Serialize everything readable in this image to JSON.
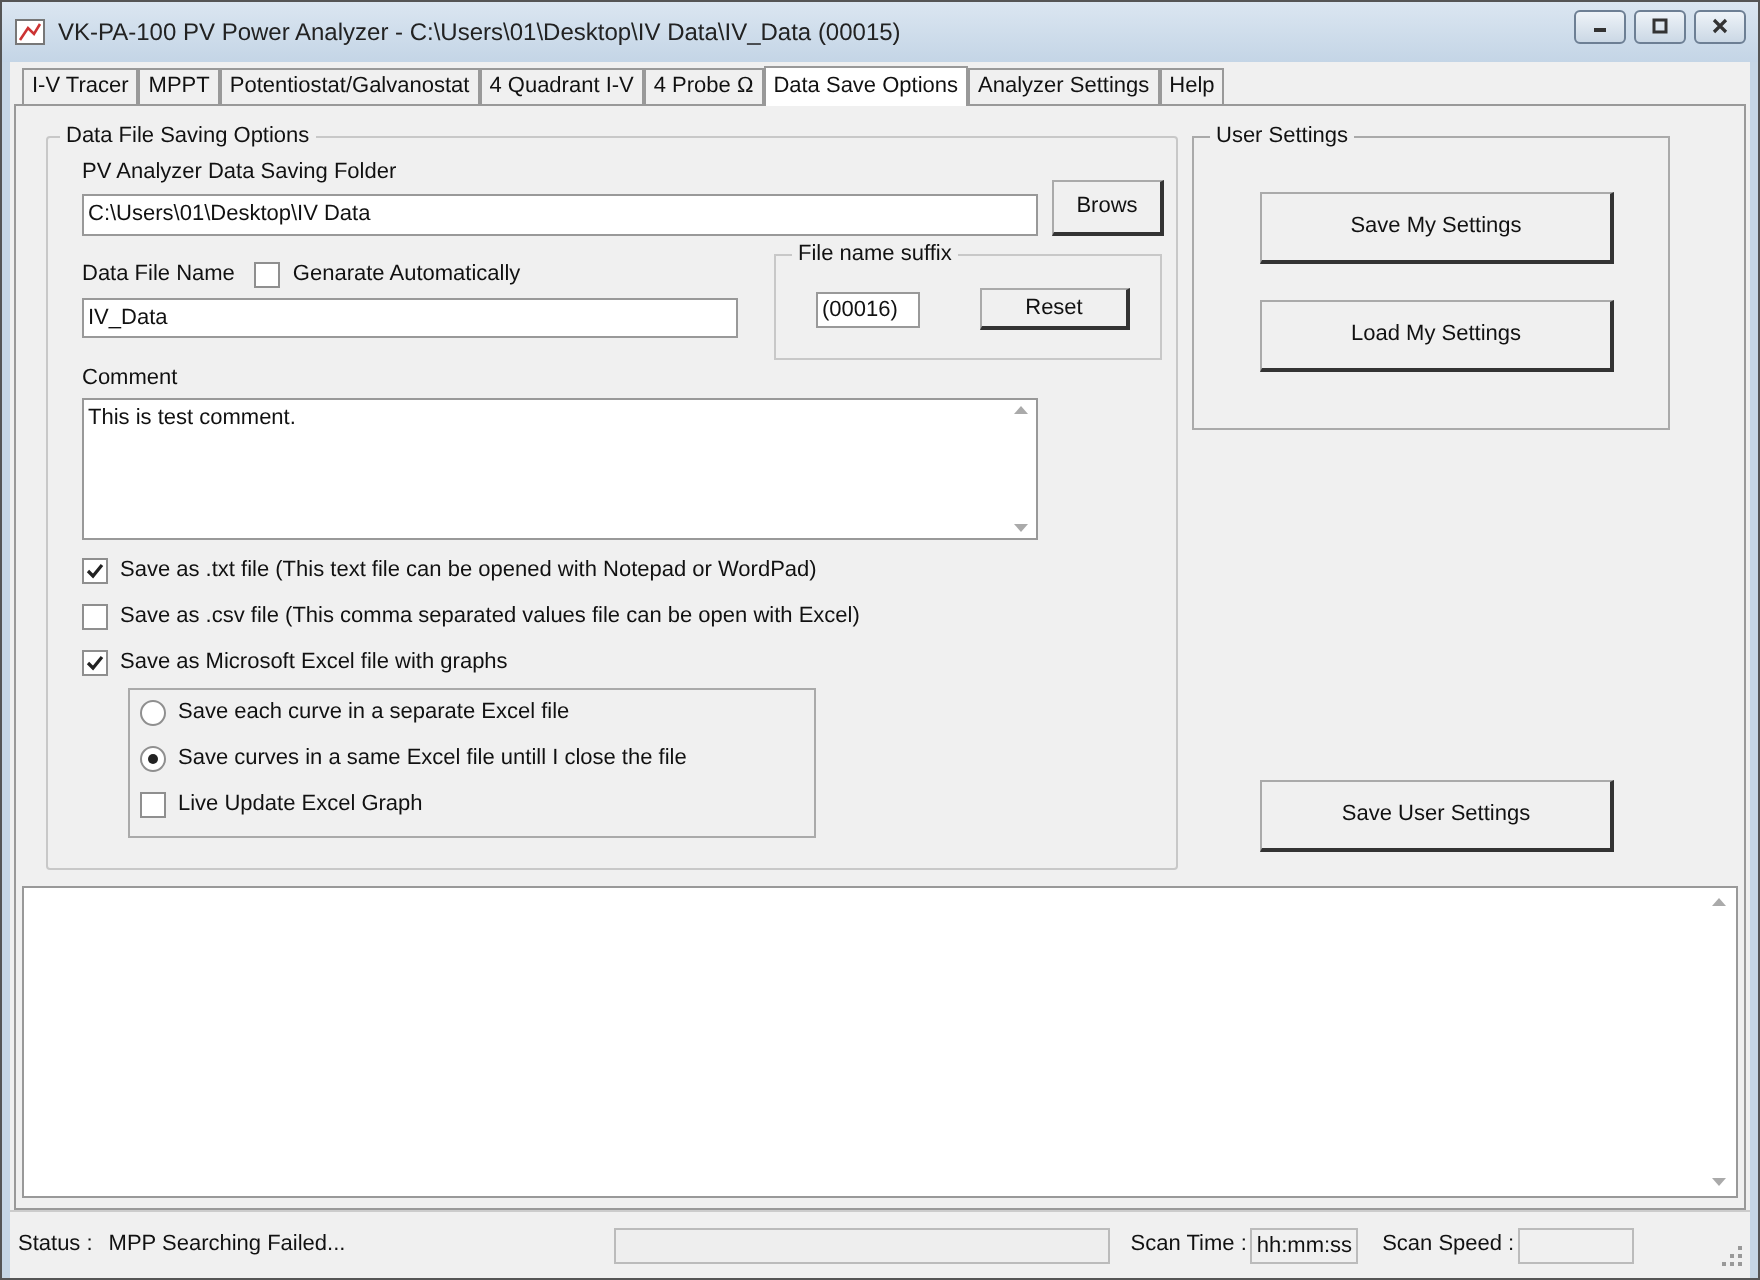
{
  "window": {
    "title": "VK-PA-100 PV Power Analyzer - C:\\Users\\01\\Desktop\\IV Data\\IV_Data (00015)"
  },
  "tabs": [
    {
      "label": "I-V Tracer",
      "selected": false
    },
    {
      "label": "MPPT",
      "selected": false
    },
    {
      "label": "Potentiostat/Galvanostat",
      "selected": false
    },
    {
      "label": "4 Quadrant I-V",
      "selected": false
    },
    {
      "label": "4 Probe Ω",
      "selected": false
    },
    {
      "label": "Data Save Options",
      "selected": true
    },
    {
      "label": "Analyzer Settings",
      "selected": false
    },
    {
      "label": "Help",
      "selected": false
    }
  ],
  "data_file_saving": {
    "title": "Data File Saving Options",
    "folder_label": "PV Analyzer Data Saving Folder",
    "folder_value": "C:\\Users\\01\\Desktop\\IV Data",
    "browse_button": "Brows",
    "file_name_label": "Data File Name",
    "auto_generate": {
      "label": "Genarate Automatically",
      "checked": false
    },
    "file_name_value": "IV_Data",
    "suffix": {
      "title": "File name suffix",
      "value": "(00016)",
      "reset_button": "Reset"
    },
    "comment_label": "Comment",
    "comment_value": "This is test comment.",
    "save_options": [
      {
        "label": "Save as .txt file (This text file can be opened with Notepad or WordPad)",
        "checked": true
      },
      {
        "label": "Save as .csv file (This comma separated values file can be open with Excel)",
        "checked": false
      },
      {
        "label": "Save as Microsoft Excel file with graphs",
        "checked": true
      }
    ],
    "excel_options": [
      {
        "kind": "radio",
        "label": "Save each curve in a separate Excel file",
        "selected": false
      },
      {
        "kind": "radio",
        "label": "Save curves in a same Excel file untill I close the file",
        "selected": true
      },
      {
        "kind": "checkbox",
        "label": "Live Update Excel Graph",
        "checked": false
      }
    ]
  },
  "user_settings": {
    "title": "User Settings",
    "buttons": [
      "Save My Settings",
      "Load My Settings"
    ]
  },
  "save_user_settings_button": "Save User Settings",
  "status_bar": {
    "status_label": "Status :",
    "status_text": "MPP Searching Failed...",
    "progress": {
      "level": 0
    },
    "scan_time_label": "Scan Time :",
    "scan_time_value": "hh:mm:ss",
    "scan_speed_label": "Scan Speed :"
  }
}
